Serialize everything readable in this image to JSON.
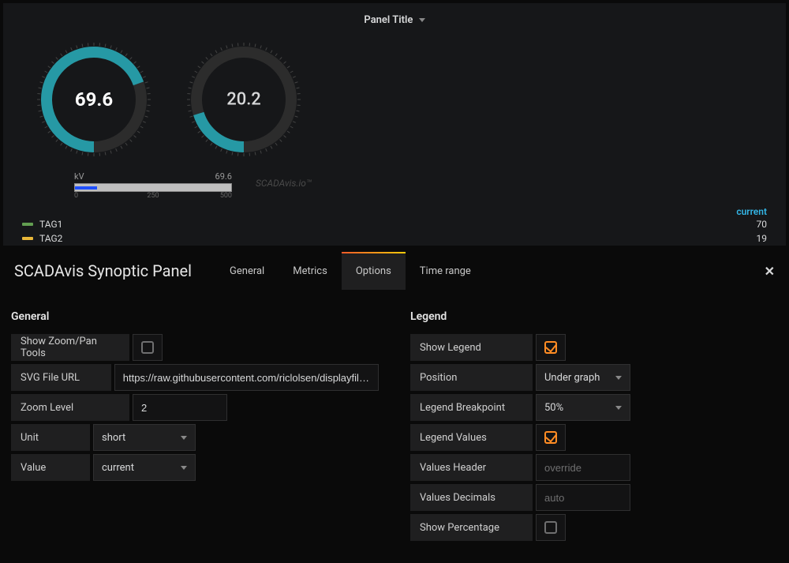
{
  "panel": {
    "title": "Panel Title",
    "gauges": [
      {
        "value": "69.6"
      },
      {
        "value": "20.2"
      }
    ],
    "bargraph": {
      "unit_label": "kV",
      "reading": "69.6",
      "tick_min": "0",
      "tick_mid": "250",
      "tick_max": "500"
    },
    "watermark": "SCADAvis.io™",
    "legend_header": "current",
    "legend_items": [
      {
        "name": "TAG1",
        "color": "#629e51",
        "value": "70"
      },
      {
        "name": "TAG2",
        "color": "#eab839",
        "value": "19"
      }
    ]
  },
  "editor": {
    "title": "SCADAvis Synoptic Panel",
    "tabs": {
      "general": "General",
      "metrics": "Metrics",
      "options": "Options",
      "timerange": "Time range"
    },
    "sections": {
      "general": "General",
      "legend": "Legend"
    },
    "labels": {
      "show_zoom": "Show Zoom/Pan Tools",
      "svg_url": "SVG File URL",
      "zoom_level": "Zoom Level",
      "unit": "Unit",
      "value": "Value",
      "show_legend": "Show Legend",
      "position": "Position",
      "legend_breakpoint": "Legend Breakpoint",
      "legend_values": "Legend Values",
      "values_header": "Values Header",
      "values_decimals": "Values Decimals",
      "show_percentage": "Show Percentage"
    },
    "values": {
      "svg_url": "https://raw.githubusercontent.com/riclolsen/displayfiles/mas…",
      "zoom_level": "2",
      "unit": "short",
      "value": "current",
      "position": "Under graph",
      "legend_breakpoint": "50%"
    },
    "placeholders": {
      "values_header": "override",
      "values_decimals": "auto"
    }
  }
}
